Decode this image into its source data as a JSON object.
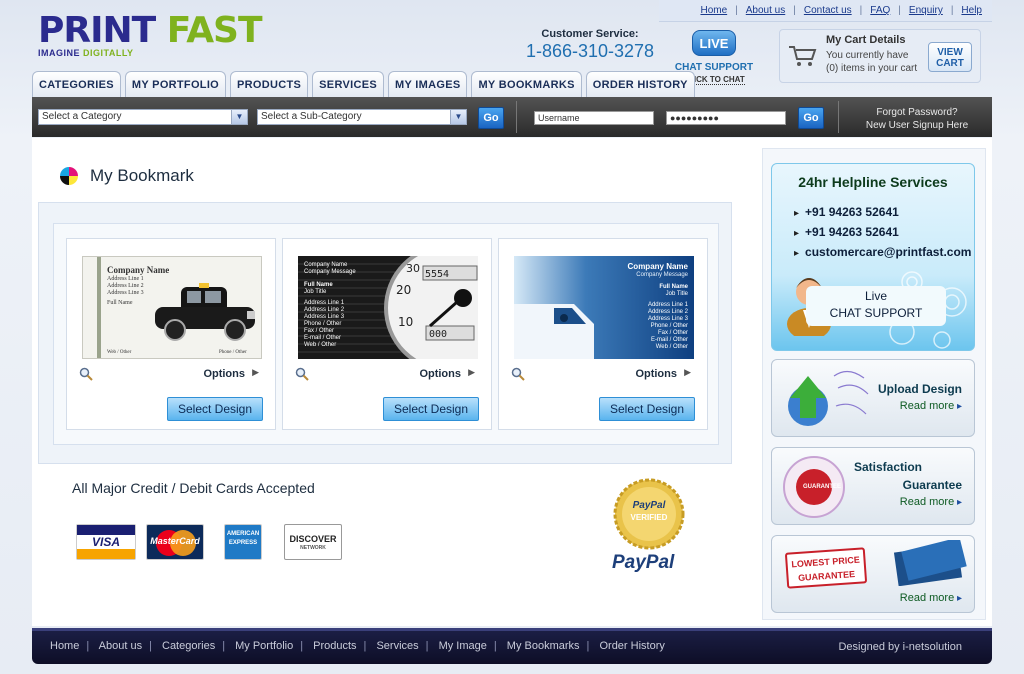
{
  "top_nav": [
    "Home",
    "About us",
    "Contact us",
    "FAQ",
    "Enquiry",
    "Help"
  ],
  "logo": {
    "brand": "PRINT",
    "brand_accent": "FAST",
    "tagline": "IMAGINE",
    "tagline_accent": "DIGITALLY"
  },
  "customer_service": {
    "label": "Customer Service:",
    "phone": "1-866-310-3278"
  },
  "live_chat": {
    "badge": "LIVE",
    "label": "CHAT SUPPORT",
    "click": "CLICK TO CHAT"
  },
  "cart": {
    "title": "My Cart Details",
    "line1": "You currently have",
    "line2": "(0) items in your cart",
    "button": "VIEW CART"
  },
  "tabs": [
    "CATEGORIES",
    "MY PORTFOLIO",
    "PRODUCTS",
    "SERVICES",
    "MY IMAGES",
    "MY BOOKMARKS",
    "ORDER HISTORY"
  ],
  "search": {
    "category": "Select a Category",
    "subcategory": "Select a Sub-Category",
    "go": "Go",
    "username": "Username",
    "password": "●●●●●●●●●",
    "login_go": "Go",
    "forgot": "Forgot Password?",
    "signup": "New User Signup Here"
  },
  "page_title": "My Bookmark",
  "cards": [
    {
      "options": "Options",
      "select": "Select Design",
      "text": {
        "company": "Company Name",
        "a1": "Address Line 1",
        "a2": "Address Line 2",
        "a3": "Address Line 3",
        "name": "Full Name",
        "web": "Web / Other",
        "phone": "Phone / Other"
      }
    },
    {
      "options": "Options",
      "select": "Select Design",
      "text": {
        "company": "Company Name",
        "msg": "Company Message",
        "name": "Full Name",
        "job": "Job Title",
        "a1": "Address Line 1",
        "a2": "Address Line 2",
        "a3": "Address Line 3",
        "phone": "Phone / Other",
        "fax": "Fax / Other",
        "email": "E-mail / Other",
        "web": "Web / Other"
      }
    },
    {
      "options": "Options",
      "select": "Select Design",
      "text": {
        "company": "Company Name",
        "msg": "Company Message",
        "name": "Full Name",
        "job": "Job Title",
        "a1": "Address Line 1",
        "a2": "Address Line 2",
        "a3": "Address Line 3",
        "phone": "Phone / Other",
        "fax": "Fax / Other",
        "email": "E-mail / Other",
        "web": "Web / Other"
      }
    }
  ],
  "payment": {
    "title": "All Major Credit / Debit Cards Accepted",
    "cards": [
      "VISA",
      "MasterCard",
      "AMERICAN EXPRESS",
      "DISCOVER"
    ],
    "discover_sub": "NETWORK",
    "paypal_seal_1": "PayPal",
    "paypal_seal_2": "VERIFIED",
    "paypal": "PayPal"
  },
  "sidebar": {
    "helpline_title": "24hr Helpline Services",
    "helpline": [
      "+91 94263 52641",
      "+91 94263 52641",
      "customercare@printfast.com"
    ],
    "live_chat_1": "Live",
    "live_chat_2": "CHAT SUPPORT",
    "upload": {
      "title": "Upload Design",
      "more": "Read more"
    },
    "satisfaction": {
      "title1": "Satisfaction",
      "title2": "Guarantee",
      "more": "Read more",
      "badge": "GUARANTEE"
    },
    "lowest": {
      "badge1": "LOWEST PRICE",
      "badge2": "GUARANTEE",
      "more": "Read more"
    }
  },
  "footer": {
    "links": [
      "Home",
      "About us",
      "Categories",
      "My Portfolio",
      "Products",
      "Services",
      "My Image",
      "My Bookmarks",
      "Order History"
    ],
    "designed": "Designed by i-netsolution"
  },
  "colors": {
    "accent_blue": "#1f6fb0",
    "nav_dark": "#2a2a2a",
    "logo_blue": "#2b2b8e",
    "logo_green": "#7fb21e",
    "footer": "#0d0e26"
  }
}
